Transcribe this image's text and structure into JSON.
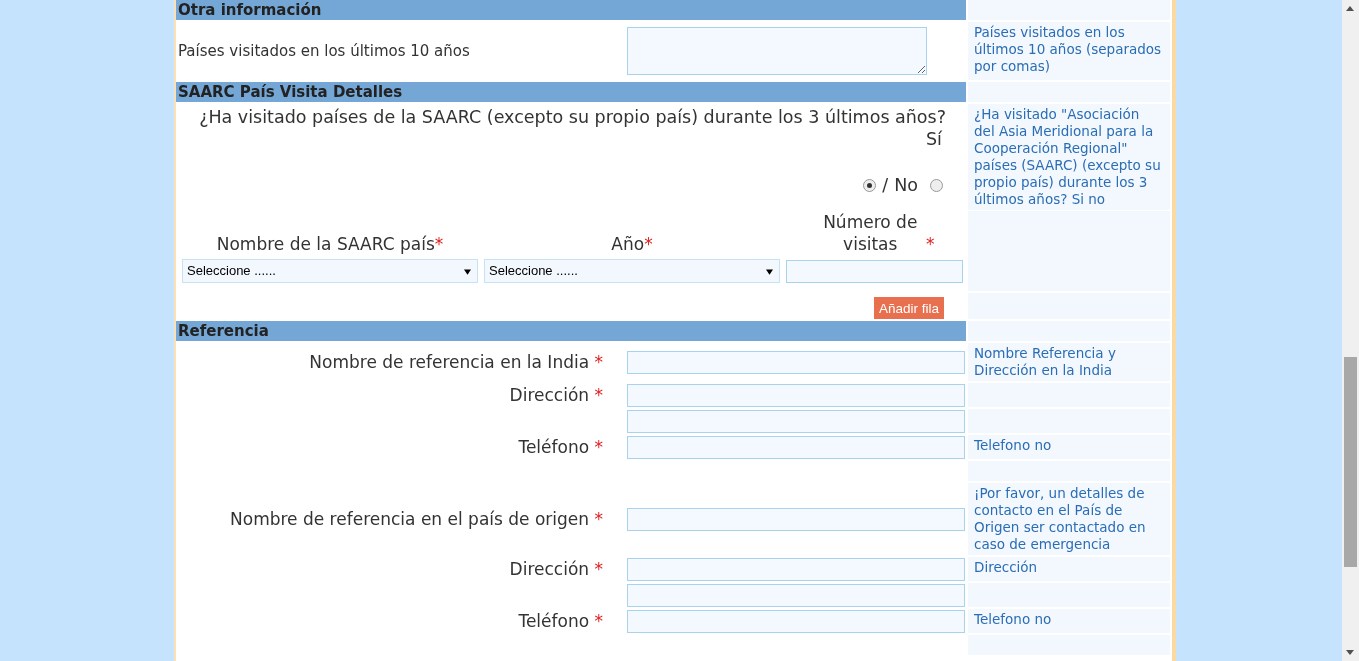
{
  "sections": [
    {
      "title": "Otra información",
      "rows": [
        {
          "kind": "textarea",
          "label": "Países visitados en los últimos 10 años",
          "help": "Países visitados en los últimos 10 años (separados por comas)"
        }
      ]
    },
    {
      "title": "SAARC País Visita Detalles",
      "rows": [
        {
          "kind": "radio",
          "question": "¿Ha visitado países de la SAARC (excepto su propio país) durante los 3 últimos años?",
          "separator": "/",
          "options": [
            {
              "label": "Sí",
              "selected": true
            },
            {
              "label": "No",
              "selected": false
            }
          ],
          "help": "¿Ha visitado \"Asociación del Asia Meridional para la Cooperación Regional\" países (SAARC) (excepto su propio país) durante los 3 últimos años? Si no"
        },
        {
          "kind": "table",
          "columns": [
            {
              "label": "Nombre de la SAARC país",
              "mark": "*"
            },
            {
              "label": "Año",
              "mark": "*"
            },
            {
              "label": "Número de visitas",
              "mark": "*"
            }
          ],
          "cells": [
            {
              "kind": "select",
              "value": "Seleccione ......"
            },
            {
              "kind": "select",
              "value": "Seleccione ......"
            },
            {
              "kind": "input"
            }
          ]
        },
        {
          "kind": "button",
          "label": "Añadir fila"
        }
      ]
    },
    {
      "title": "Referencia",
      "rows": [
        {
          "kind": "input",
          "label": "Nombre de referencia en la India",
          "mark": "*",
          "help": "Nombre Referencia y Dirección en la India"
        },
        {
          "kind": "input",
          "label": "Dirección",
          "mark": "*"
        },
        {
          "kind": "input"
        },
        {
          "kind": "input",
          "label": "Teléfono",
          "mark": "*",
          "help": "Telefono no"
        },
        {
          "kind": "spacer"
        },
        {
          "kind": "input",
          "label": "Nombre de referencia en el país de origen",
          "mark": "*",
          "help": "¡Por favor, un detalles de contacto en el País de Origen ser contactado en caso de emergencia"
        },
        {
          "kind": "input",
          "label": "Dirección",
          "mark": "*",
          "help": "Dirección"
        },
        {
          "kind": "input"
        },
        {
          "kind": "input",
          "label": "Teléfono",
          "mark": "*",
          "help": "Telefono no"
        },
        {
          "kind": "spacer"
        }
      ]
    }
  ]
}
